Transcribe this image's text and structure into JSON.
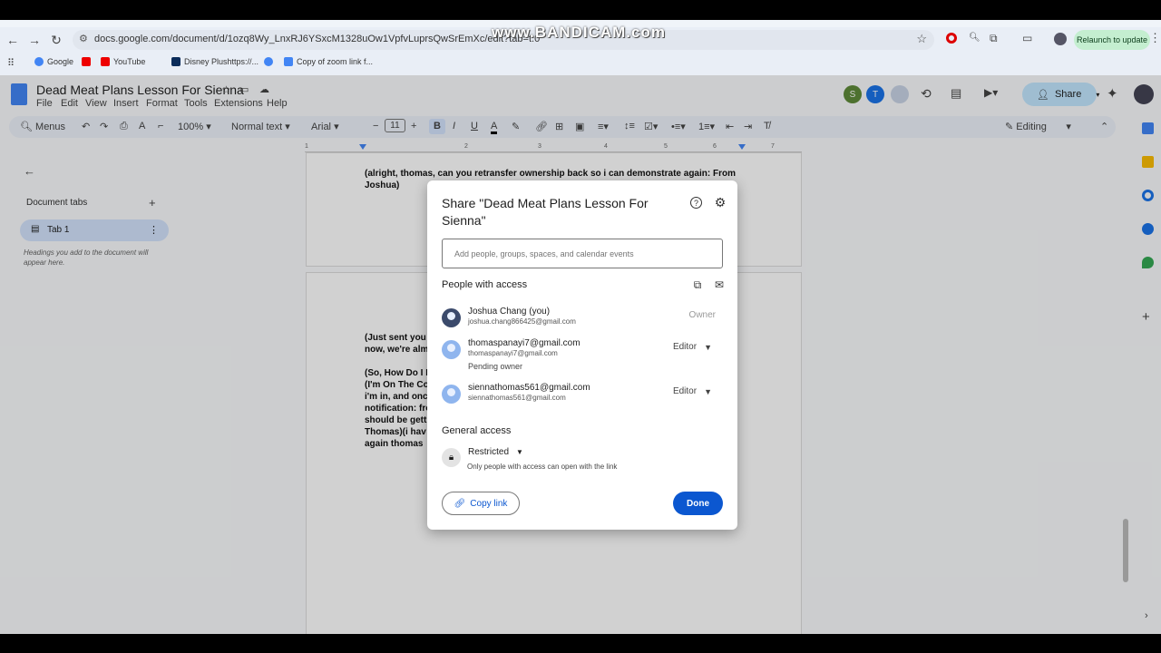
{
  "browser": {
    "url": "docs.google.com/document/d/1ozq8Wy_LnxRJ6YSxcM1328uOw1VpfvLuprsQwSrEmXc/edit?tab=t.0",
    "relaunch_label": "Relaunch to update",
    "watermark": "www.BANDICAM.com",
    "bookmarks": [
      "Google",
      "YouTube",
      "Disney Plushttps://...",
      "Copy of zoom link f..."
    ]
  },
  "doc": {
    "title": "Dead Meat Plans Lesson For Sienna",
    "menus": [
      "File",
      "Edit",
      "View",
      "Insert",
      "Format",
      "Tools",
      "Extensions",
      "Help"
    ],
    "share_label": "Share",
    "avatars": [
      "S",
      "T"
    ],
    "toolbar": {
      "menus_search": "Menus",
      "zoom": "100%",
      "style": "Normal text",
      "font": "Arial",
      "font_size": "11",
      "mode": "Editing"
    },
    "ruler_ticks": [
      "1",
      "2",
      "3",
      "4",
      "5",
      "6",
      "7"
    ],
    "side": {
      "document_tabs": "Document tabs",
      "tab1": "Tab 1",
      "hint": "Headings you add to the document will appear here."
    },
    "page1_text": "(alright, thomas, can you retransfer  ownership back so i can demonstrate again:  From Joshua)",
    "page2_lines": [
      "(Just sent you",
      "now, we're  alm",
      "",
      "(So, How Do I D",
      "(I'm On The Co",
      "i'm in, and onc",
      "notification: fro",
      "should be  gett",
      "Thomas)(i  hav",
      "again   thomas"
    ]
  },
  "dialog": {
    "title": "Share \"Dead Meat Plans Lesson For Sienna\"",
    "add_placeholder": "Add people, groups, spaces, and calendar events",
    "people_heading": "People with access",
    "people": [
      {
        "name": "Joshua Chang (you)",
        "email": "joshua.chang866425@gmail.com",
        "role": "Owner",
        "sub": ""
      },
      {
        "name": "thomaspanayi7@gmail.com",
        "email": "thomaspanayi7@gmail.com",
        "role": "Editor",
        "sub": "Pending owner"
      },
      {
        "name": "siennathomas561@gmail.com",
        "email": "siennathomas561@gmail.com",
        "role": "Editor",
        "sub": ""
      }
    ],
    "general_heading": "General access",
    "access_level": "Restricted",
    "access_desc": "Only people with access can open with the link",
    "copy_link": "Copy link",
    "done": "Done"
  }
}
